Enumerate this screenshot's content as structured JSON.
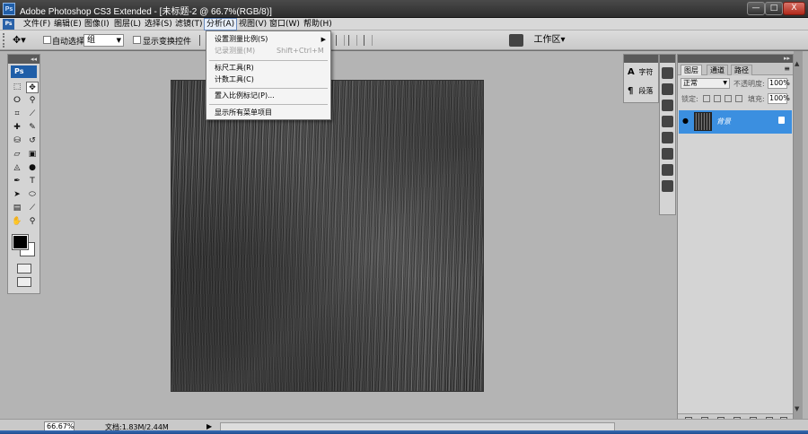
{
  "window": {
    "app_badge": "Ps",
    "title": "Adobe Photoshop CS3 Extended - [未标题-2 @ 66.7%(RGB/8)]",
    "btn_min": "—",
    "btn_max": "□",
    "btn_close": "X"
  },
  "menubar": {
    "items": [
      "文件(F)",
      "编辑(E)",
      "图像(I)",
      "图层(L)",
      "选择(S)",
      "滤镜(T)",
      "分析(A)",
      "视图(V)",
      "窗口(W)",
      "帮助(H)"
    ],
    "active": "分析(A)"
  },
  "options": {
    "auto_select_label": "自动选择:",
    "auto_select_value": "组",
    "show_transform_label": "显示变换控件",
    "workspace_label": "工作区▾"
  },
  "analysis_menu": {
    "items": [
      {
        "label": "设置测量比例(S)",
        "shortcut": "",
        "submenu": true,
        "disabled": false
      },
      {
        "label": "记录测量(M)",
        "shortcut": "Shift+Ctrl+M",
        "submenu": false,
        "disabled": true
      },
      {
        "label": "标尺工具(R)",
        "shortcut": "",
        "submenu": false,
        "disabled": false
      },
      {
        "label": "计数工具(C)",
        "shortcut": "",
        "submenu": false,
        "disabled": false
      },
      {
        "label": "置入比例标记(P)...",
        "shortcut": "",
        "submenu": false,
        "disabled": false
      },
      {
        "label": "显示所有菜单项目",
        "shortcut": "",
        "submenu": false,
        "disabled": false
      }
    ]
  },
  "toolbox": {
    "badge": "Ps",
    "collapse": "◂◂"
  },
  "mini_panel": {
    "char_label": "字符",
    "para_label": "段落"
  },
  "layers_panel": {
    "tabs": [
      "图层",
      "通道",
      "路径"
    ],
    "blend_mode": "正常",
    "opacity_label": "不透明度:",
    "opacity_value": "100%",
    "lock_label": "锁定:",
    "fill_label": "填充:",
    "fill_value": "100%",
    "layer_name": "背景"
  },
  "status": {
    "zoom": "66.67%",
    "doc_info": "文档:1.83M/2.44M"
  },
  "colors": {
    "accent": "#3b8fe0",
    "foreground_swatch": "#000000",
    "background_swatch": "#ffffff"
  }
}
